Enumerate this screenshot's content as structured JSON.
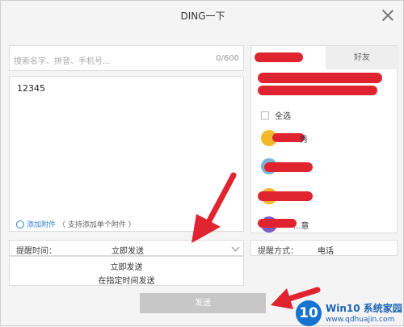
{
  "dialog": {
    "title": "DING一下"
  },
  "left": {
    "search_placeholder": "搜索名字、拼音、手机号...",
    "char_count": "0/600",
    "message": "12345",
    "attach_link": "添加附件",
    "attach_hint": "（ 支持添加单个附件 ）"
  },
  "remind": {
    "label": "提醒时间：",
    "value": "立即发送",
    "options": [
      "立即发送",
      "在指定时间发送"
    ]
  },
  "right": {
    "tabs": [
      "友有...",
      "好友"
    ],
    "select_all": "全选",
    "people": [
      "秀",
      "",
      "",
      "...意"
    ],
    "remind_way_label": "提醒方式：",
    "remind_way_value": "电话"
  },
  "send_button": "发送",
  "watermark": {
    "logo": "10",
    "title": "Win10 系统家园",
    "url": "www.qdhuajin.com"
  },
  "colors": {
    "annotation_red": "#e0242f",
    "send_bg": "#c7c7c7",
    "link": "#2f80d1"
  }
}
